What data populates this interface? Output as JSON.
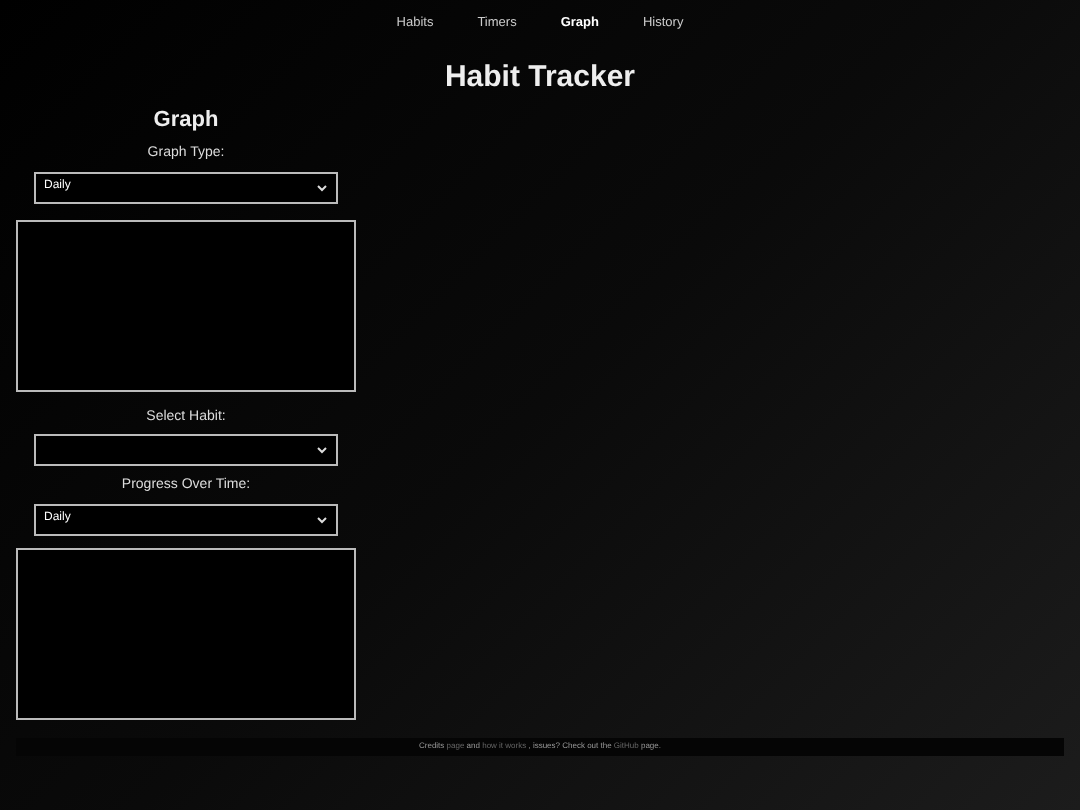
{
  "nav": [
    {
      "label": "Habits",
      "selected": false
    },
    {
      "label": "Timers",
      "selected": false
    },
    {
      "label": "Graph",
      "selected": true
    },
    {
      "label": "History",
      "selected": false
    }
  ],
  "title": "Habit Tracker",
  "panel": {
    "heading": "Graph",
    "graph_type_label": "Graph Type:",
    "graph_type_value": "Daily",
    "select_habit_label": "Select Habit:",
    "progress_label": "Progress Over Time:",
    "progress_value": "Daily"
  },
  "footer": [
    {
      "kind": "text",
      "text": "Credits"
    },
    {
      "kind": "link",
      "text": "page"
    },
    {
      "kind": "text",
      "text": "and"
    },
    {
      "kind": "link",
      "text": "how it works"
    },
    {
      "kind": "text",
      "text": ", issues? Check out the"
    },
    {
      "kind": "link",
      "text": "GitHub"
    },
    {
      "kind": "text",
      "text": "page."
    }
  ]
}
